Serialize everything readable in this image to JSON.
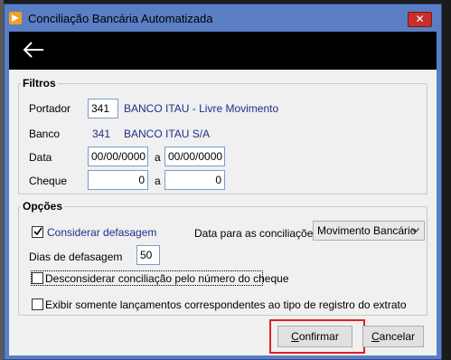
{
  "window": {
    "title": "Conciliação Bancária Automatizada",
    "close_glyph": "✕"
  },
  "icons": {
    "app": "app-logo-icon",
    "back": "back-arrow-icon",
    "close": "close-icon",
    "checkbox_checked": "checkmark-icon",
    "dropdown": "chevron-down-icon"
  },
  "filtros": {
    "legend": "Filtros",
    "portador": {
      "label": "Portador",
      "code": "341",
      "name": "BANCO ITAU - Livre Movimento"
    },
    "banco": {
      "label": "Banco",
      "code": "341",
      "name": "BANCO ITAU S/A"
    },
    "data": {
      "label": "Data",
      "from": "00/00/0000",
      "separator": "a",
      "to": "00/00/0000"
    },
    "cheque": {
      "label": "Cheque",
      "from": "0",
      "separator": "a",
      "to": "0"
    }
  },
  "opcoes": {
    "legend": "Opções",
    "considerar_defasagem": {
      "label": "Considerar defasagem",
      "checked": true
    },
    "data_conciliacoes": {
      "label": "Data para as conciliações",
      "selected": "Movimento Bancário"
    },
    "dias_defasagem": {
      "label": "Dias de defasagem",
      "value": "50"
    },
    "desconsiderar": {
      "label": "Desconsiderar conciliação pelo número do cheque",
      "checked": false
    },
    "exibir": {
      "label": "Exibir somente lançamentos correspondentes ao tipo de registro do extrato",
      "checked": false
    }
  },
  "buttons": {
    "confirmar": {
      "label": "Confirmar",
      "mnemonic": "C",
      "rest": "onfirmar"
    },
    "cancelar": {
      "label": "Cancelar",
      "mnemonic": "C",
      "rest": "ancelar"
    }
  },
  "colors": {
    "title_bar": "#5a7ec4",
    "header_bar": "#000000",
    "link_blue": "#1e2f8c",
    "close_red": "#c7302a",
    "highlight_red": "#e02020"
  }
}
